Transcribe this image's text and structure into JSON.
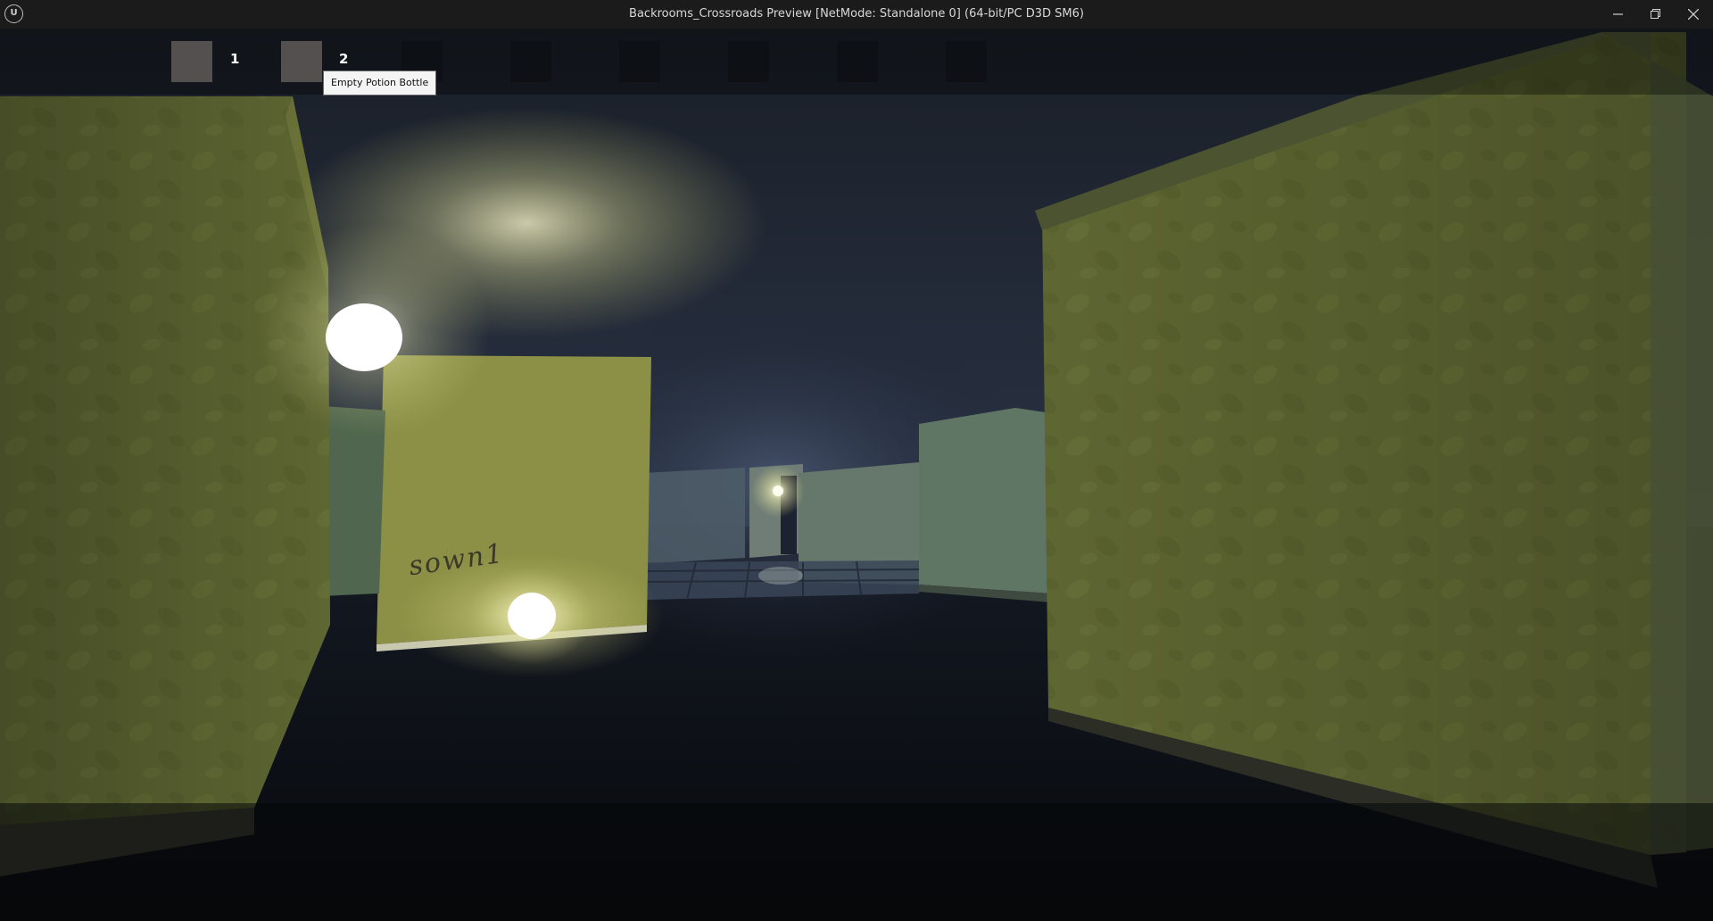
{
  "window": {
    "title": "Backrooms_Crossroads Preview [NetMode: Standalone 0]  (64-bit/PC D3D SM6)",
    "logo_text": "U",
    "controls": [
      {
        "name": "minimize-button",
        "icon": "minimize-icon"
      },
      {
        "name": "restore-button",
        "icon": "restore-icon"
      },
      {
        "name": "close-button",
        "icon": "close-icon"
      }
    ]
  },
  "hud": {
    "hotbar": {
      "slots": [
        {
          "number": "1",
          "filled": true
        },
        {
          "number": "2",
          "filled": true
        },
        {
          "number": "",
          "filled": false
        },
        {
          "number": "",
          "filled": false
        },
        {
          "number": "",
          "filled": false
        },
        {
          "number": "",
          "filled": false
        },
        {
          "number": "",
          "filled": false
        },
        {
          "number": "",
          "filled": false
        }
      ],
      "tooltip": "Empty Potion Bottle"
    }
  },
  "scene": {
    "wall_writing": "sown1",
    "colors": {
      "wallpaper": "#5c6430",
      "floor": "#0c0f14",
      "light": "#fffce0",
      "fog": "#3a4660"
    }
  }
}
